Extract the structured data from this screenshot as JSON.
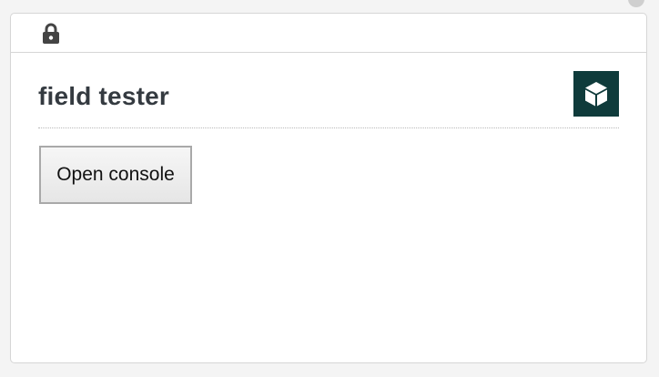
{
  "card": {
    "title": "field tester",
    "open_console_label": "Open console"
  },
  "icons": {
    "lock": "lock-icon",
    "cube": "cube-icon"
  },
  "colors": {
    "badge_background": "#0f3b3b",
    "title_text": "#343a40"
  }
}
